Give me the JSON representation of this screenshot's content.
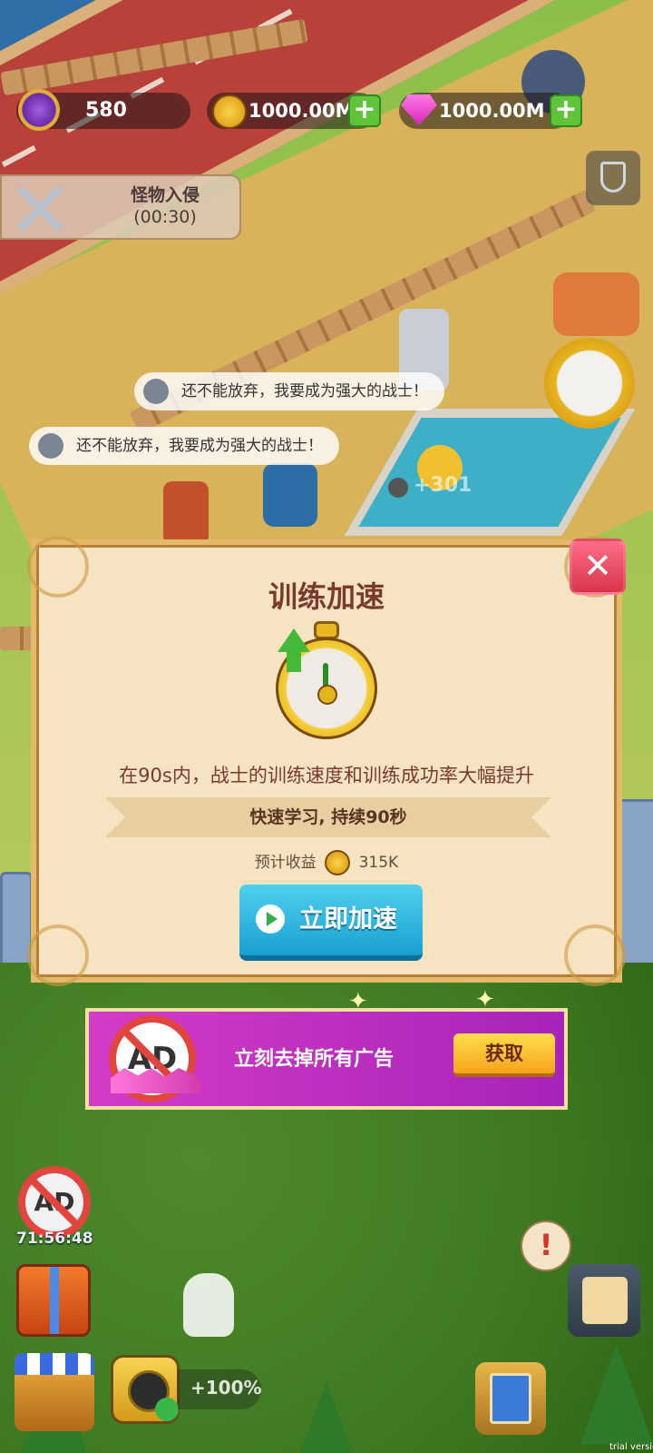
{
  "hud": {
    "level_value": "580",
    "coins_value": "1000.00M",
    "gems_value": "1000.00M",
    "plus_symbol": "+"
  },
  "event": {
    "title": "怪物入侵",
    "timer": "(00:30)"
  },
  "speech": [
    "还不能放弃，我要成为强大的战士！",
    "还不能放弃，我要成为强大的战士！"
  ],
  "floating_gain": "+301",
  "dialog": {
    "title": "训练加速",
    "description": "在90s内，战士的训练速度和训练成功率大幅提升",
    "banner": "快速学习, 持续90秒",
    "revenue_label": "预计收益",
    "revenue_value": "315K",
    "button_label": "立即加速",
    "close_symbol": "✕"
  },
  "ad_banner": {
    "icon_text": "AD",
    "text": "立刻去掉所有广告",
    "button_label": "获取"
  },
  "bottom": {
    "noad_icon_text": "AD",
    "noad_timer": "71:56:48",
    "boost_label": "+100%",
    "alert_symbol": "!"
  },
  "watermark": "trial version",
  "colors": {
    "dialog_bg": "#f5e3c2",
    "title_color": "#7a3b2a",
    "button_blue": "#1aa0d0",
    "close_red": "#d8344d",
    "ad_purple": "#c22fc0",
    "get_yellow": "#f4a41c"
  }
}
